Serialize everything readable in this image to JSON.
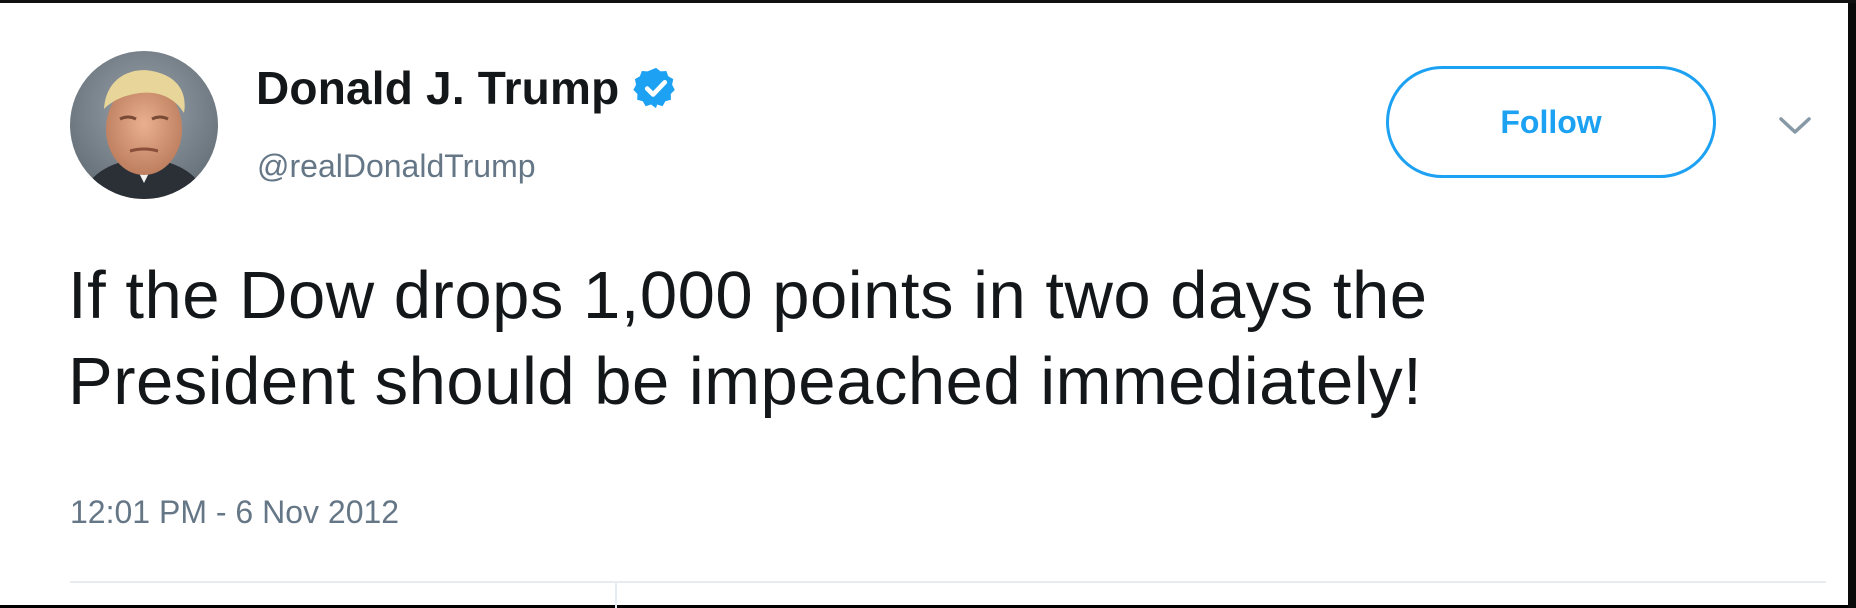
{
  "user": {
    "display_name": "Donald J. Trump",
    "handle": "@realDonaldTrump",
    "verified": true,
    "avatar_icon": "profile-photo"
  },
  "actions": {
    "follow_label": "Follow",
    "more_icon": "chevron-down-icon"
  },
  "tweet": {
    "text_line_1": "If the Dow drops 1,000 points in two days the",
    "text_line_2": "President should be impeached immediately!",
    "timestamp": "12:01 PM - 6 Nov 2012"
  },
  "colors": {
    "accent": "#1da1f2",
    "text": "#14171a",
    "secondary_text": "#657786",
    "divider": "#e6ecf0"
  }
}
